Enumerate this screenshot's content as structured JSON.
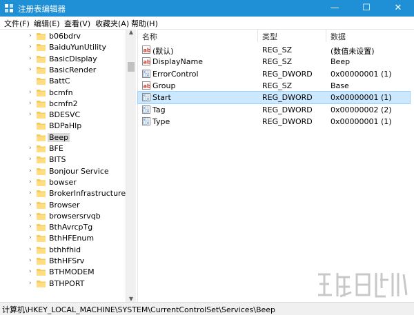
{
  "window": {
    "title": "注册表编辑器",
    "minimize": "—",
    "maximize": "☐",
    "close": "✕"
  },
  "menu": [
    "文件(F)",
    "编辑(E)",
    "查看(V)",
    "收藏夹(A)",
    "帮助(H)"
  ],
  "tree": {
    "items": [
      {
        "label": "b06bdrv",
        "expandable": true
      },
      {
        "label": "BaiduYunUtility",
        "expandable": true
      },
      {
        "label": "BasicDisplay",
        "expandable": true
      },
      {
        "label": "BasicRender",
        "expandable": true
      },
      {
        "label": "BattC",
        "expandable": false
      },
      {
        "label": "bcmfn",
        "expandable": true
      },
      {
        "label": "bcmfn2",
        "expandable": true
      },
      {
        "label": "BDESVC",
        "expandable": true
      },
      {
        "label": "BDPaHlp",
        "expandable": false
      },
      {
        "label": "Beep",
        "expandable": false,
        "selected": true
      },
      {
        "label": "BFE",
        "expandable": true
      },
      {
        "label": "BITS",
        "expandable": true
      },
      {
        "label": "Bonjour Service",
        "expandable": true
      },
      {
        "label": "bowser",
        "expandable": true
      },
      {
        "label": "BrokerInfrastructure",
        "expandable": true
      },
      {
        "label": "Browser",
        "expandable": true
      },
      {
        "label": "browsersrvqb",
        "expandable": true
      },
      {
        "label": "BthAvrcpTg",
        "expandable": true
      },
      {
        "label": "BthHFEnum",
        "expandable": true
      },
      {
        "label": "bthhfhid",
        "expandable": true
      },
      {
        "label": "BthHFSrv",
        "expandable": true
      },
      {
        "label": "BTHMODEM",
        "expandable": true
      },
      {
        "label": "BTHPORT",
        "expandable": true
      }
    ]
  },
  "columns": {
    "name": "名称",
    "type": "类型",
    "data": "数据"
  },
  "values": [
    {
      "name": "(默认)",
      "type": "REG_SZ",
      "data": "(数值未设置)",
      "icon": "string-value-icon"
    },
    {
      "name": "DisplayName",
      "type": "REG_SZ",
      "data": "Beep",
      "icon": "string-value-icon"
    },
    {
      "name": "ErrorControl",
      "type": "REG_DWORD",
      "data": "0x00000001 (1)",
      "icon": "binary-value-icon"
    },
    {
      "name": "Group",
      "type": "REG_SZ",
      "data": "Base",
      "icon": "string-value-icon"
    },
    {
      "name": "Start",
      "type": "REG_DWORD",
      "data": "0x00000001 (1)",
      "icon": "binary-value-icon",
      "selected": true
    },
    {
      "name": "Tag",
      "type": "REG_DWORD",
      "data": "0x00000002 (2)",
      "icon": "binary-value-icon"
    },
    {
      "name": "Type",
      "type": "REG_DWORD",
      "data": "0x00000001 (1)",
      "icon": "binary-value-icon"
    }
  ],
  "status": {
    "path": "计算机\\HKEY_LOCAL_MACHINE\\SYSTEM\\CurrentControlSet\\Services\\Beep"
  },
  "colors": {
    "titlebar": "#1f8fd6",
    "folder": "#f4cc5a",
    "selection": "#cce8ff"
  }
}
